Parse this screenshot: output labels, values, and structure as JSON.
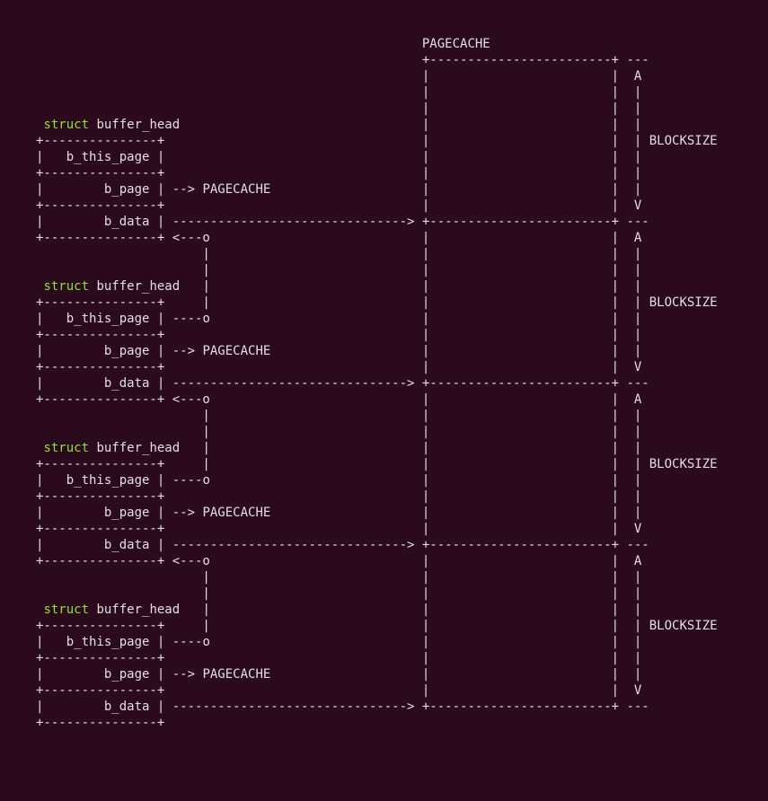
{
  "diagram": {
    "pagecache_label": "PAGECACHE",
    "blocksize_label": "BLOCKSIZE",
    "struct_keyword": "struct",
    "struct_name": "buffer_head",
    "fields": {
      "b_this_page": "b_this_page",
      "b_page": "b_page",
      "b_data": "b_data"
    },
    "b_page_target": "--> PAGECACHE"
  }
}
